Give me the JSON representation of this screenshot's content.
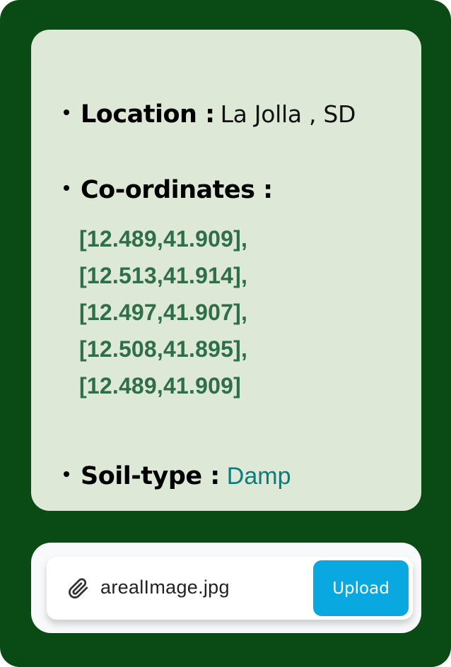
{
  "info": {
    "location_label": "Location :",
    "location_value": "La Jolla , SD",
    "coords_label": "Co-ordinates :",
    "coordinates": [
      "[12.489,41.909],",
      "[12.513,41.914],",
      "[12.497,41.907],",
      "[12.508,41.895],",
      "[12.489,41.909]"
    ],
    "soil_label": "Soil-type :",
    "soil_value": "Damp"
  },
  "upload": {
    "file_name": "arealImage.jpg",
    "button_label": "Upload",
    "attach_icon": "paperclip-icon"
  },
  "colors": {
    "frame_bg": "#0a4a14",
    "card_bg": "#dde8d7",
    "coord_text": "#2f6f48",
    "soil_value": "#0a7c7c",
    "button_bg": "#0aa8e0"
  }
}
